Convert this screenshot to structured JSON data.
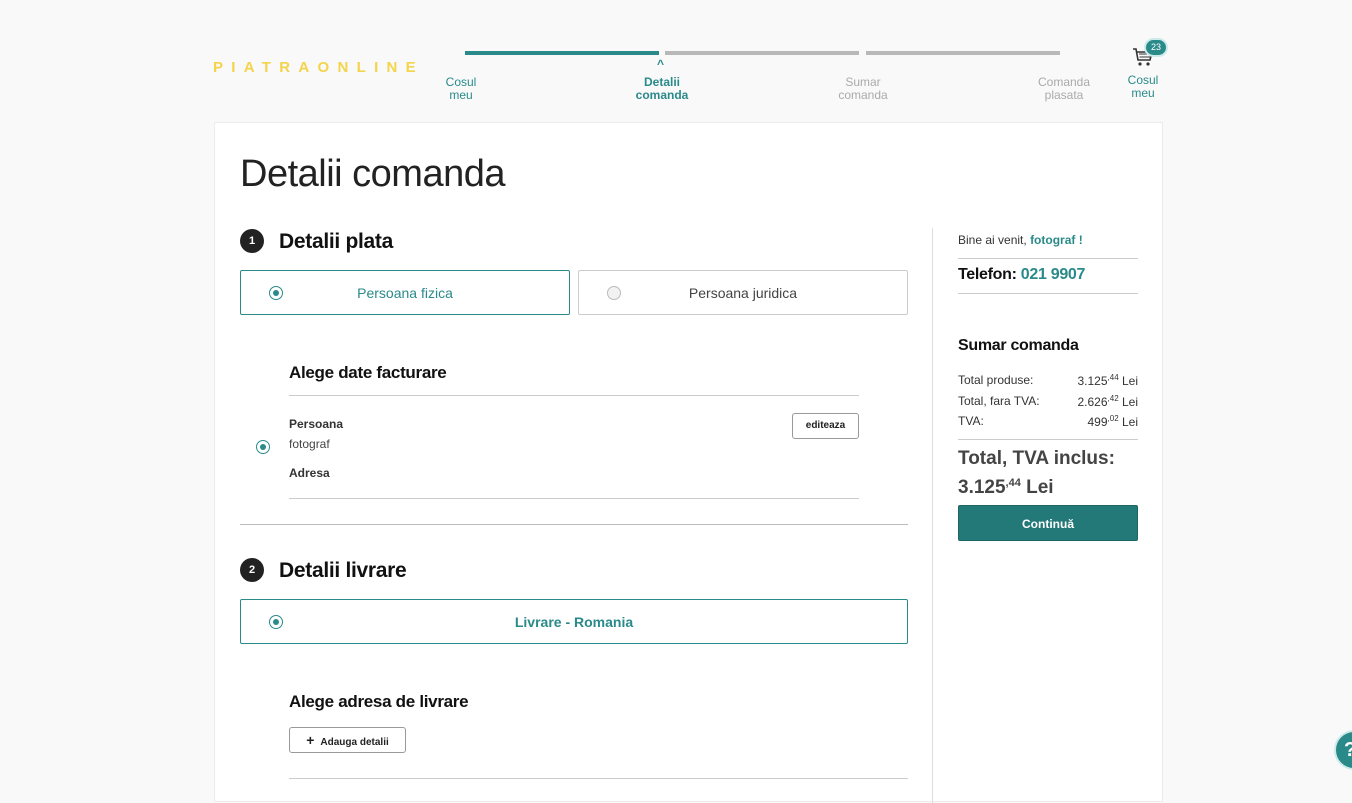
{
  "logo": "PIATRAONLINE",
  "steps": [
    {
      "label_1": "Cosul",
      "label_2": "meu"
    },
    {
      "label_1": "Detalii",
      "label_2": "comanda",
      "caret": "^"
    },
    {
      "label_1": "Sumar",
      "label_2": "comanda"
    },
    {
      "label_1": "Comanda",
      "label_2": "plasata"
    }
  ],
  "cart": {
    "count": "23",
    "label_1": "Cosul",
    "label_2": "meu",
    "icon": "cart-icon"
  },
  "page_title": "Detalii comanda",
  "section_payment": {
    "number": "1",
    "title": "Detalii plata",
    "options": [
      {
        "label": "Persoana fizica",
        "selected": true
      },
      {
        "label": "Persoana juridica",
        "selected": false
      }
    ],
    "billing_title": "Alege date facturare",
    "person_label": "Persoana",
    "person_value": "fotograf",
    "address_label": "Adresa",
    "edit_button": "editeaza"
  },
  "section_delivery": {
    "number": "2",
    "title": "Detalii livrare",
    "option": "Livrare - Romania",
    "address_title": "Alege adresa de livrare",
    "add_button": "Adauga detalii",
    "add_icon": "+"
  },
  "sidebar": {
    "welcome": "Bine ai venit,",
    "username": "fotograf !",
    "phone_label": "Telefon:",
    "phone_number": "021 9907",
    "summary_title": "Sumar comanda",
    "rows": [
      {
        "label": "Total produse:",
        "int": "3.125",
        "dec": ",44",
        "currency": "Lei"
      },
      {
        "label": "Total, fara TVA:",
        "int": "2.626",
        "dec": ",42",
        "currency": "Lei"
      },
      {
        "label": "TVA:",
        "int": "499",
        "dec": ",02",
        "currency": "Lei"
      }
    ],
    "total_label": "Total, TVA inclus:",
    "total_int": "3.125",
    "total_dec": ",44",
    "total_currency": "Lei",
    "continue_button": "Continuă"
  },
  "colors": {
    "accent": "#2a8a8a",
    "logo": "#f3d44b",
    "button": "#237878"
  },
  "help_icon": "?"
}
